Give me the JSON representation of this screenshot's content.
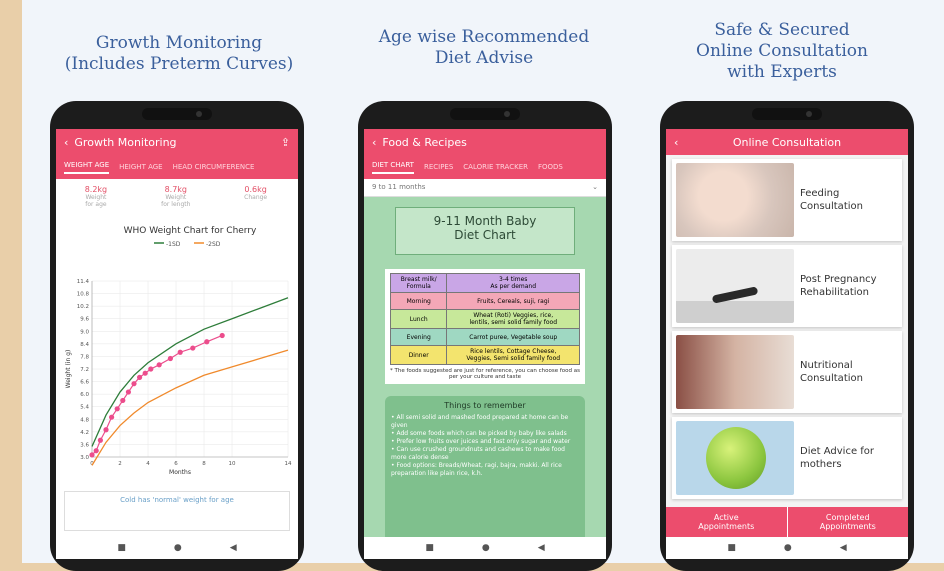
{
  "captions": {
    "c1": "Growth Monitoring\n(Includes Preterm Curves)",
    "c2": "Age wise Recommended\nDiet Advise",
    "c3": "Safe & Secured\nOnline Consultation\nwith Experts"
  },
  "growth": {
    "title": "Growth Monitoring",
    "tabs": [
      "WEIGHT AGE",
      "HEIGHT AGE",
      "HEAD CIRCUMFERENCE"
    ],
    "stats": [
      {
        "value": "8.2kg",
        "label": "Weight\nfor age"
      },
      {
        "value": "8.7kg",
        "label": "Weight\nfor length"
      },
      {
        "value": "0.6kg",
        "label": "Change"
      }
    ],
    "footer_text": "Cold has 'normal' weight for age"
  },
  "chart_data": {
    "type": "line",
    "title": "WHO Weight Chart for Cherry",
    "xlabel": "Months",
    "ylabel": "Weight (in g)",
    "x_ticks": [
      "0",
      "2",
      "4",
      "6",
      "8",
      "10",
      "14"
    ],
    "y_ticks": [
      "3.0",
      "3.6",
      "4.2",
      "4.8",
      "5.4",
      "6.0",
      "6.6",
      "7.2",
      "7.8",
      "8.4",
      "9.0",
      "9.6",
      "10.2",
      "10.8",
      "11.4"
    ],
    "xlim": [
      0,
      14
    ],
    "ylim": [
      3.0,
      11.4
    ],
    "series": [
      {
        "name": "-1SD",
        "color": "#2e7d3a",
        "x": [
          0,
          1,
          2,
          3,
          4,
          6,
          8,
          10,
          12,
          14
        ],
        "y": [
          3.5,
          5.0,
          6.1,
          6.9,
          7.5,
          8.4,
          9.1,
          9.6,
          10.1,
          10.6
        ]
      },
      {
        "name": "-2SD",
        "color": "#f08a2c",
        "x": [
          0,
          1,
          2,
          3,
          4,
          6,
          8,
          10,
          12,
          14
        ],
        "y": [
          2.6,
          3.7,
          4.5,
          5.1,
          5.6,
          6.3,
          6.9,
          7.3,
          7.7,
          8.1
        ]
      },
      {
        "name": "Cherry",
        "color": "#ec4d8c",
        "x": [
          0,
          0.3,
          0.6,
          1,
          1.4,
          1.8,
          2.2,
          2.6,
          3,
          3.4,
          3.8,
          4.2,
          4.8,
          5.6,
          6.3,
          7.2,
          8.2,
          9.3
        ],
        "y": [
          3.1,
          3.3,
          3.8,
          4.3,
          4.9,
          5.3,
          5.7,
          6.1,
          6.5,
          6.8,
          7.0,
          7.2,
          7.4,
          7.7,
          8.0,
          8.2,
          8.5,
          8.8
        ]
      }
    ]
  },
  "food": {
    "title": "Food & Recipes",
    "tabs": [
      "DIET CHART",
      "RECIPES",
      "CALORIE TRACKER",
      "FOODS"
    ],
    "select_value": "9 to 11 months",
    "card_title": "9-11 Month Baby\nDiet Chart",
    "table_header": [
      "Breast milk/\nFormula",
      "3-4 times\nAs per demand"
    ],
    "rows": [
      [
        "Morning",
        "Fruits, Cereals, suji, ragi"
      ],
      [
        "Lunch",
        "Wheat (Roti) Veggies, rice,\nlentils, semi solid family food"
      ],
      [
        "Evening",
        "Carrot puree, Vegetable soup"
      ],
      [
        "Dinner",
        "Rice lentils, Cottage Cheese,\nVeggies, Semi solid family food"
      ]
    ],
    "table_note": "* The foods suggested are just for reference, you can choose food as per your culture and taste",
    "remember_title": "Things to remember",
    "remember_items": [
      "All semi solid and mashed food prepared at home can be given",
      "Add some foods which can be picked by baby like salads",
      "Prefer low fruits over juices and fast only sugar and water",
      "Can use crushed groundnuts and cashews to make food more calorie dense",
      "Food options: Breads/Wheat, ragi, bajra, makki. All rice preparation like plain rice, k.h."
    ]
  },
  "consult": {
    "title": "Online Consultation",
    "services": [
      {
        "label": "Feeding\nConsultation",
        "color": "#d8c6bd"
      },
      {
        "label": "Post Pregnancy\nRehabilitation",
        "color": "#dedede"
      },
      {
        "label": "Nutritional\nConsultation",
        "color": "#c9a895"
      },
      {
        "label": "Diet Advice for\nmothers",
        "color": "#b9d7ea"
      }
    ],
    "bottom_tabs": [
      "Active\nAppointments",
      "Completed\nAppointments"
    ]
  },
  "nav": {
    "square": "■",
    "circle": "●",
    "back": "◀"
  },
  "colors": {
    "accent": "#ec4d6d",
    "green_card": "#9fd6a8",
    "caption": "#3a5f9c"
  }
}
